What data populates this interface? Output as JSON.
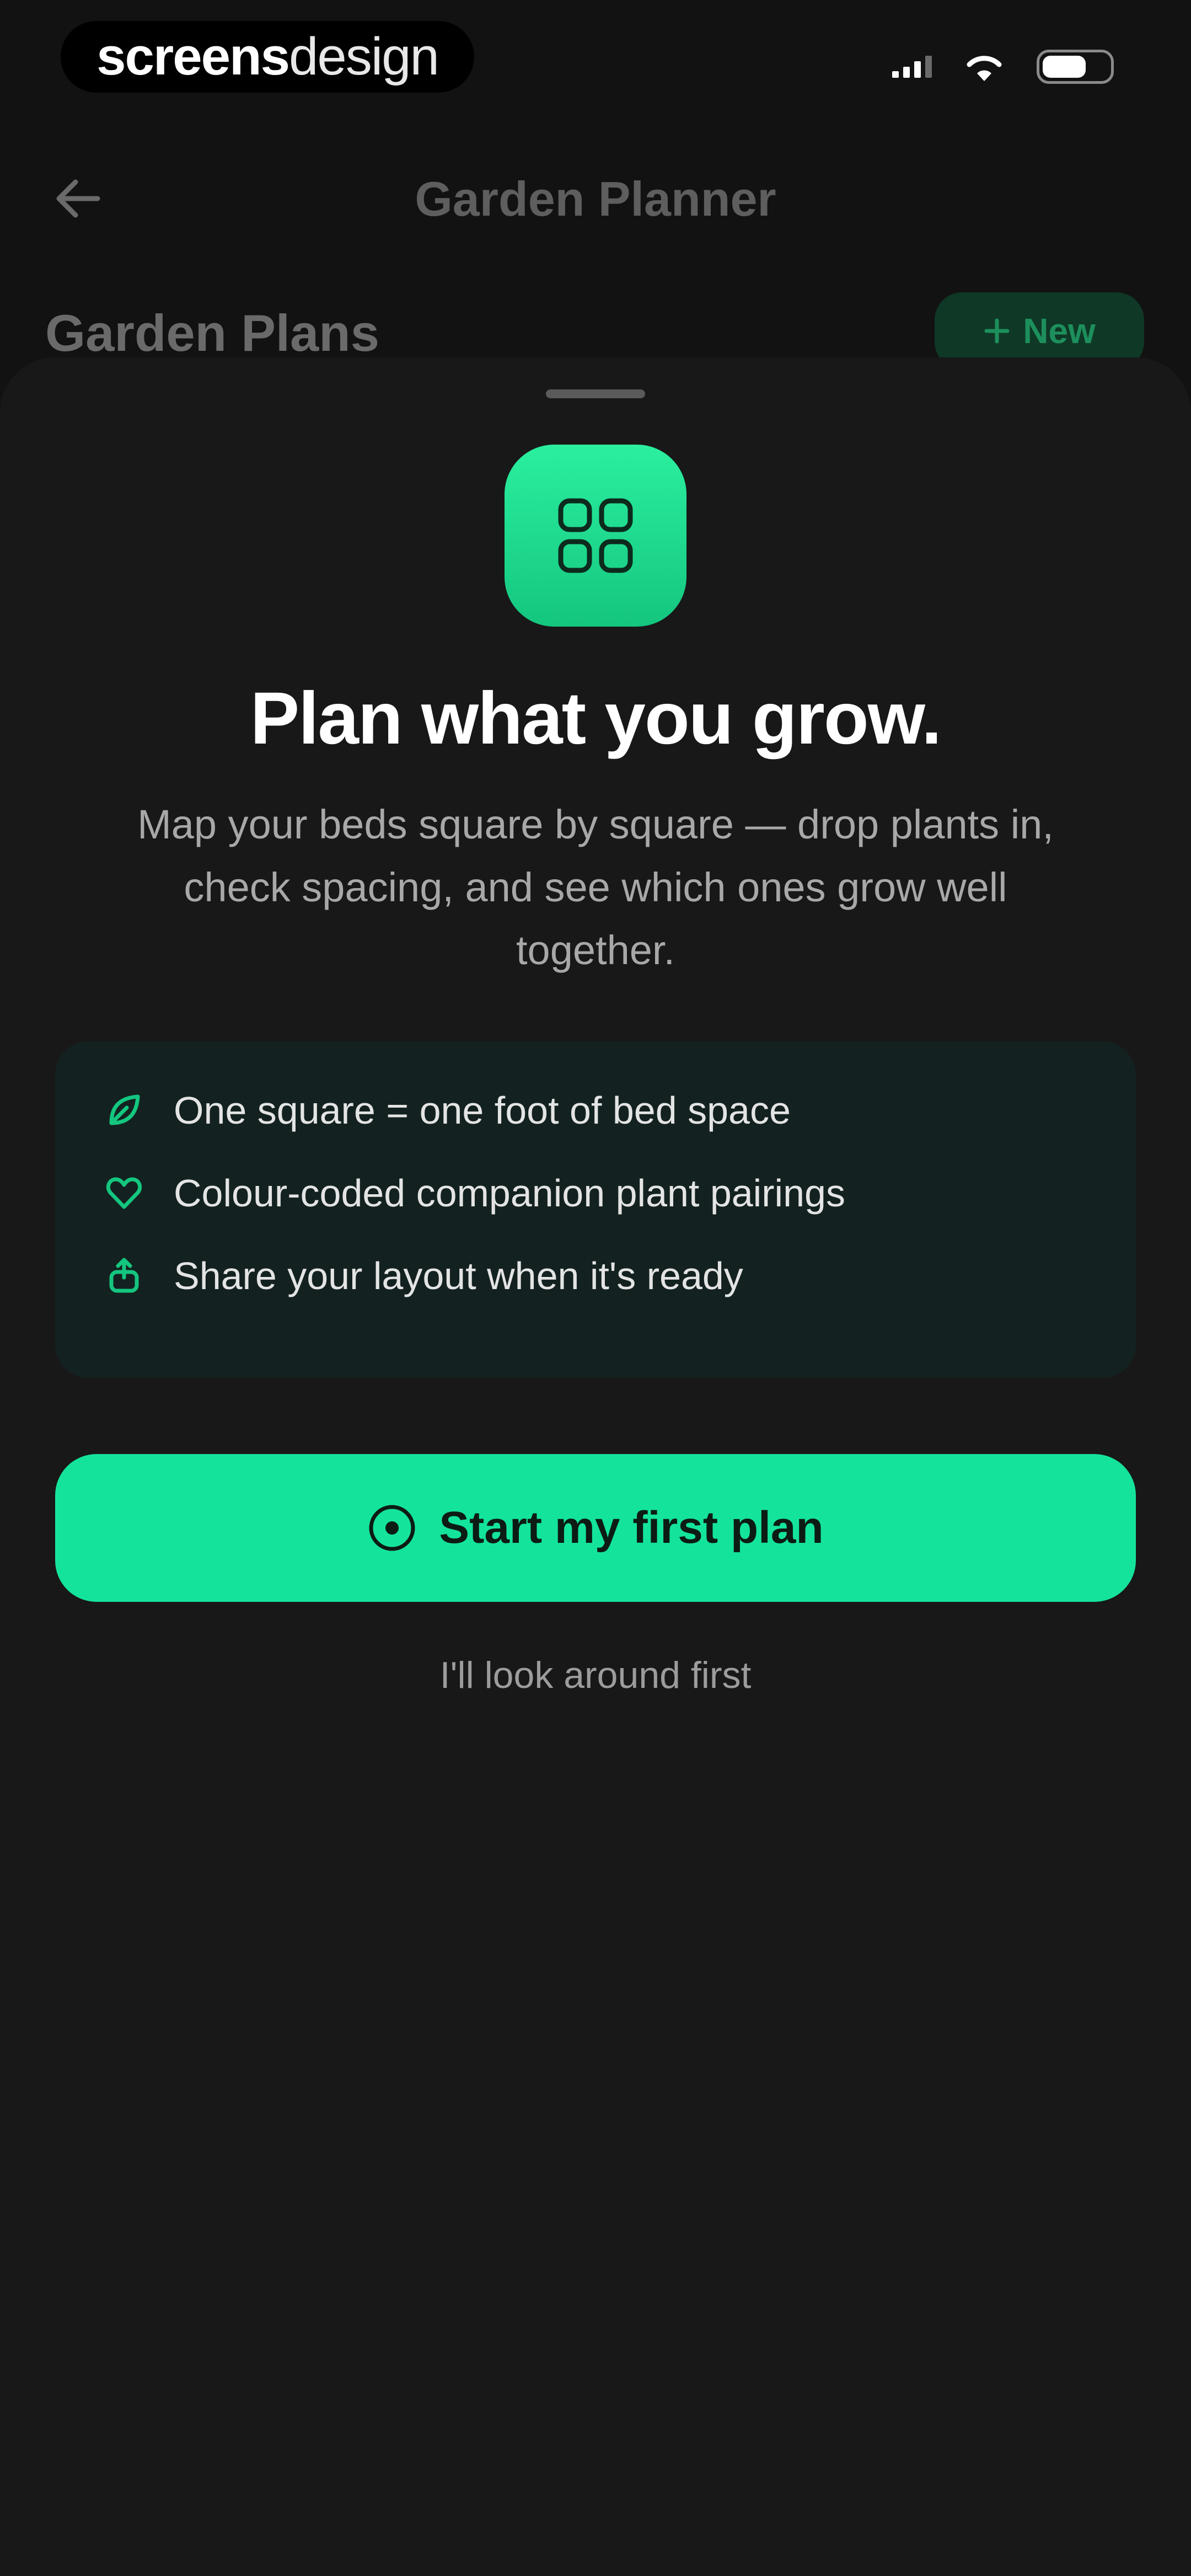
{
  "status_bar": {
    "brand_part1": "screens",
    "brand_part2": "design"
  },
  "nav": {
    "title": "Garden Planner",
    "back_icon": "arrow-left-icon"
  },
  "list_header": {
    "title": "Garden Plans",
    "new_label": "New",
    "new_icon": "plus-icon"
  },
  "sheet": {
    "icon": "grid-icon",
    "headline": "Plan what you grow.",
    "subtext": "Map your beds square by square — drop plants in, check spacing, and see which ones grow well together.",
    "features": [
      {
        "icon": "leaf-icon",
        "label": "One square = one foot of bed space"
      },
      {
        "icon": "heart-icon",
        "label": "Colour-coded companion plant pairings"
      },
      {
        "icon": "share-icon",
        "label": "Share your layout when it's ready"
      }
    ],
    "primary_button": "Start my first plan",
    "primary_icon": "target-icon",
    "secondary_link": "I'll look around first"
  },
  "colors": {
    "accent": "#14e49b",
    "background": "#121212",
    "sheet": "#181818",
    "feature_card": "#132220"
  }
}
